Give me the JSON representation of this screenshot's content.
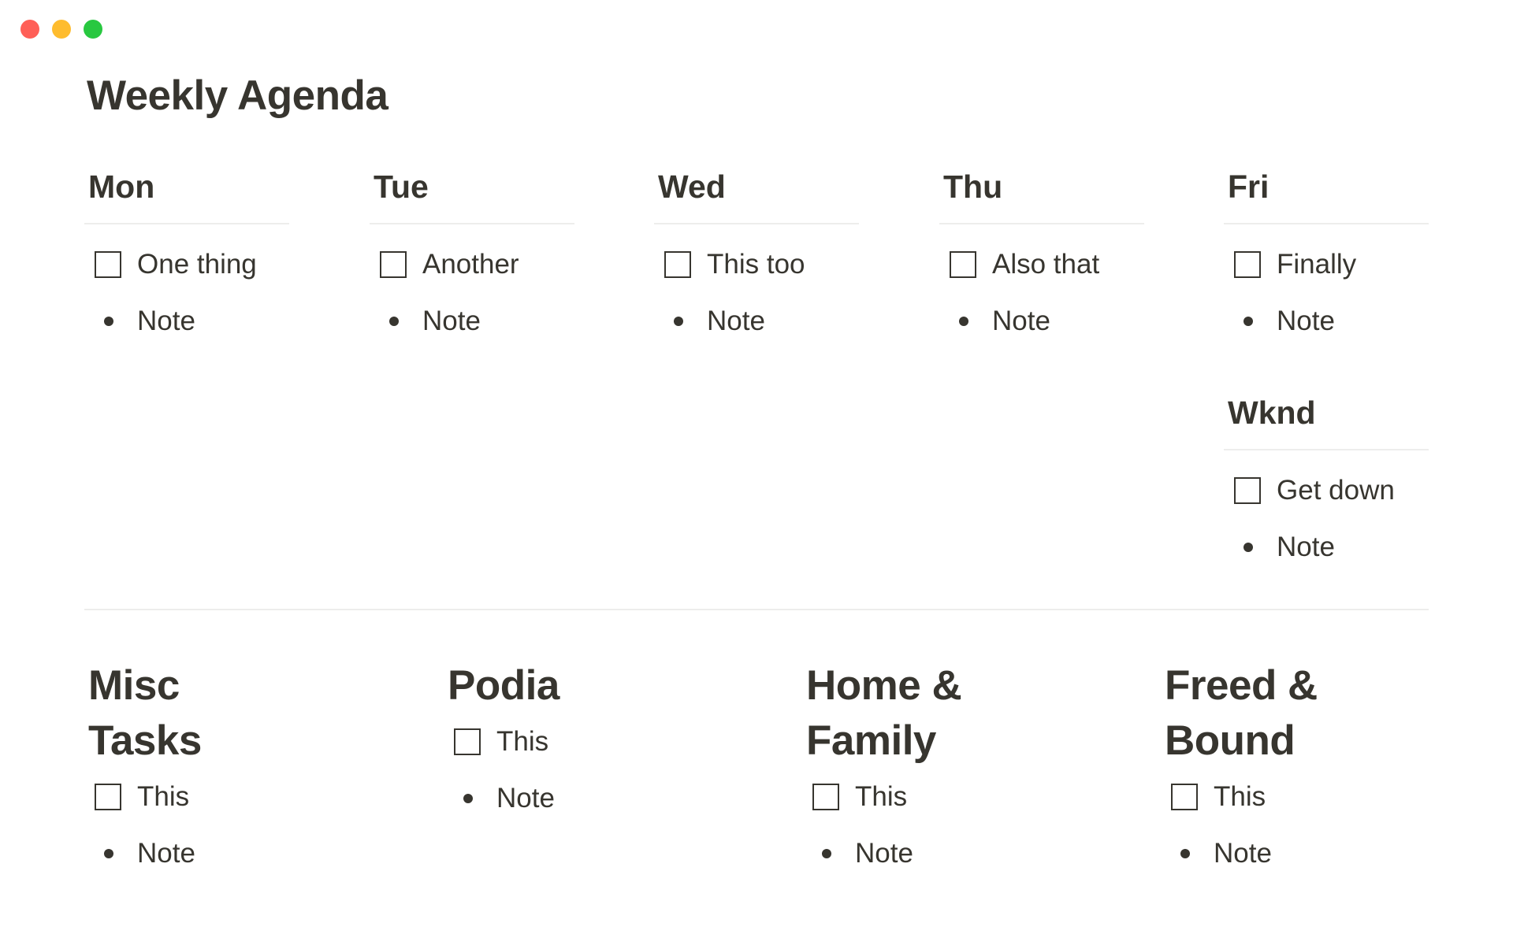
{
  "window": {
    "controls": [
      {
        "name": "close",
        "color": "#ff5f57"
      },
      {
        "name": "minimize",
        "color": "#febc2e"
      },
      {
        "name": "zoom",
        "color": "#28c840"
      }
    ]
  },
  "page": {
    "title": "Weekly Agenda"
  },
  "days": [
    {
      "heading": "Mon",
      "task": "One thing",
      "note": "Note"
    },
    {
      "heading": "Tue",
      "task": "Another",
      "note": "Note"
    },
    {
      "heading": "Wed",
      "task": "This too",
      "note": "Note"
    },
    {
      "heading": "Thu",
      "task": "Also that",
      "note": "Note"
    },
    {
      "heading": "Fri",
      "task": "Finally",
      "note": "Note"
    },
    {
      "heading": "Wknd",
      "task": "Get down",
      "note": "Note"
    }
  ],
  "categories": [
    {
      "heading": "Misc Tasks",
      "task": "This",
      "note": "Note"
    },
    {
      "heading": "Podia",
      "task": "This",
      "note": "Note"
    },
    {
      "heading": "Home & Family",
      "task": "This",
      "note": "Note"
    },
    {
      "heading": "Freed & Bound",
      "task": "This",
      "note": "Note"
    }
  ],
  "colors": {
    "text": "#37352f",
    "divider": "#ededec",
    "background": "#ffffff"
  }
}
